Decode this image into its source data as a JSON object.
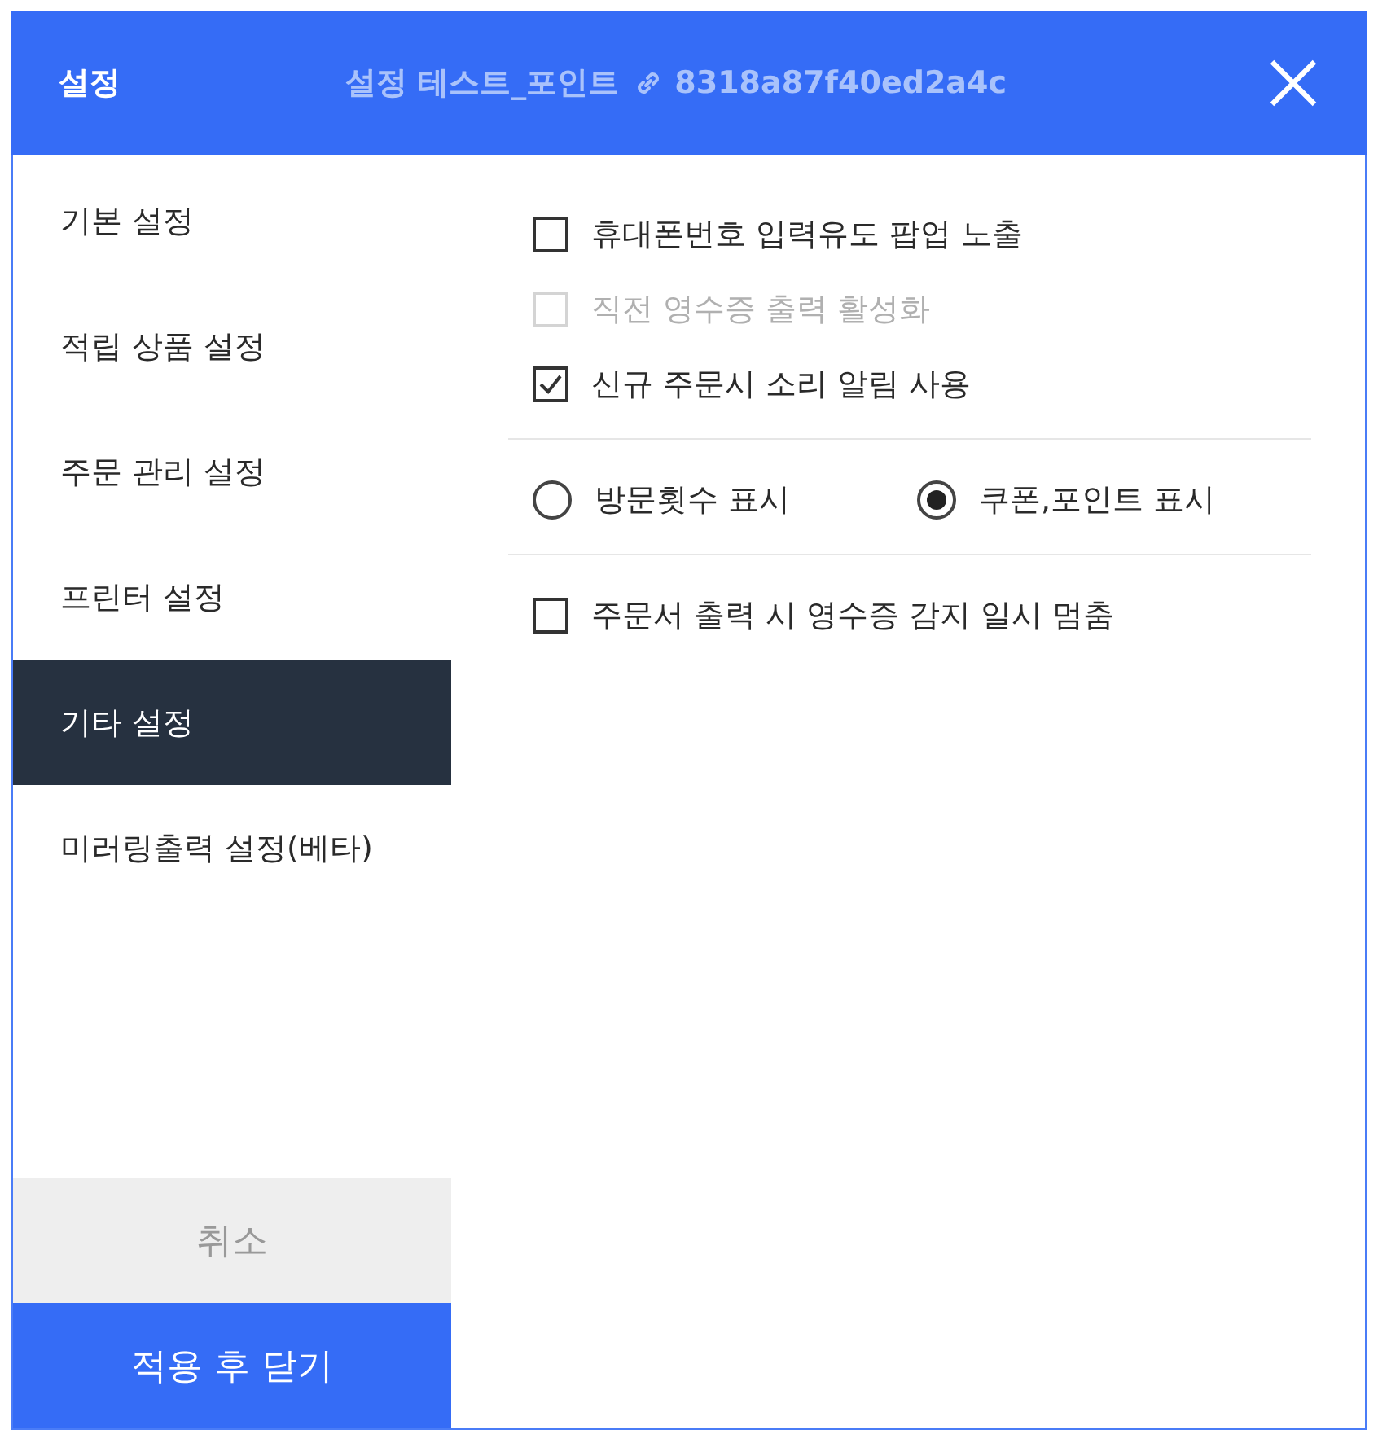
{
  "window": {
    "title": "설정",
    "subtitle": "설정 테스트_포인트",
    "link_id": "8318a87f40ed2a4c"
  },
  "sidebar": {
    "items": [
      {
        "label": "기본 설정",
        "selected": false
      },
      {
        "label": "적립 상품 설정",
        "selected": false
      },
      {
        "label": "주문 관리 설정",
        "selected": false
      },
      {
        "label": "프린터 설정",
        "selected": false
      },
      {
        "label": "기타 설정",
        "selected": true
      },
      {
        "label": "미러링출력 설정(베타)",
        "selected": false
      }
    ]
  },
  "sections": [
    {
      "kind": "checkboxes",
      "items": [
        {
          "label": "휴대폰번호 입력유도 팝업 노출",
          "checked": false,
          "disabled": false
        },
        {
          "label": "직전 영수증 출력 활성화",
          "checked": false,
          "disabled": true
        },
        {
          "label": "신규 주문시 소리 알림 사용",
          "checked": true,
          "disabled": false
        }
      ]
    },
    {
      "kind": "radios",
      "items": [
        {
          "label": "방문횟수 표시",
          "selected": false
        },
        {
          "label": "쿠폰,포인트 표시",
          "selected": true
        }
      ]
    },
    {
      "kind": "checkboxes",
      "items": [
        {
          "label": "주문서 출력 시 영수증 감지 일시 멈춤",
          "checked": false,
          "disabled": false
        }
      ]
    }
  ],
  "buttons": [
    {
      "label": "취소",
      "kind": "secondary"
    },
    {
      "label": "적용 후 닫기",
      "kind": "primary"
    }
  ]
}
